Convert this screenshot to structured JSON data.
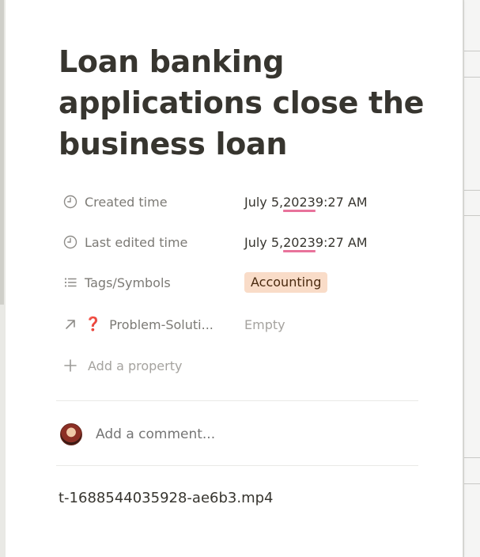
{
  "page": {
    "title": "Loan banking applications close the business loan"
  },
  "properties": [
    {
      "icon": "clock-icon",
      "label": "Created time",
      "value": "July 5, 2023 9:27 AM",
      "value_parts": [
        "July 5, ",
        "2023",
        " 9:27 AM"
      ]
    },
    {
      "icon": "clock-icon",
      "label": "Last edited time",
      "value": "July 5, 2023 9:27 AM",
      "value_parts": [
        "July 5, ",
        "2023",
        " 9:27 AM"
      ]
    },
    {
      "icon": "list-icon",
      "label": "Tags/Symbols",
      "tag": "Accounting",
      "tag_color": "#f9dcc8"
    },
    {
      "icon": "arrow-up-right-icon",
      "label_prefix": "❓",
      "label": "Problem-Soluti...",
      "value": "Empty"
    }
  ],
  "add_property": {
    "label": "Add a property",
    "icon": "plus-icon"
  },
  "comment": {
    "placeholder": "Add a comment..."
  },
  "attachment": {
    "file_name": "t-1688544035928-ae6b3.mp4"
  },
  "colors": {
    "accent_underline": "#e8739b",
    "tag_bg": "#f9dcc8"
  }
}
